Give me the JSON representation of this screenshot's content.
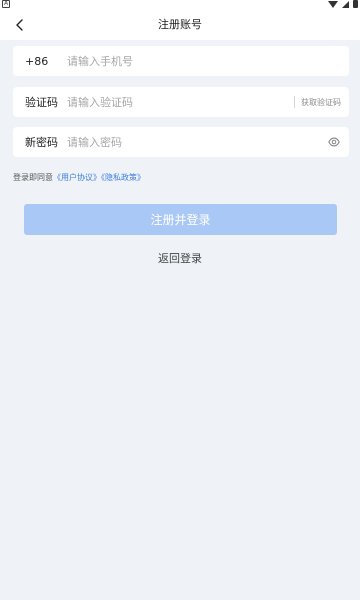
{
  "header": {
    "title": "注册账号",
    "back_icon": "chevron-left-icon"
  },
  "form": {
    "phone": {
      "prefix": "+86",
      "placeholder": "请输入手机号",
      "value": ""
    },
    "code": {
      "label": "验证码",
      "placeholder": "请输入验证码",
      "value": "",
      "get_code_label": "获取验证码"
    },
    "password": {
      "label": "新密码",
      "placeholder": "请输入密码",
      "value": "",
      "toggle_icon": "eye-icon"
    }
  },
  "agreement": {
    "prefix": "登录即同意",
    "user_agreement": "《用户协议》",
    "privacy_policy": "《隐私政策》"
  },
  "actions": {
    "submit_label": "注册并登录",
    "back_login_label": "返回登录"
  },
  "colors": {
    "background": "#eff3f8",
    "primary_disabled": "#a9c8f5",
    "link": "#3d7ee0"
  }
}
